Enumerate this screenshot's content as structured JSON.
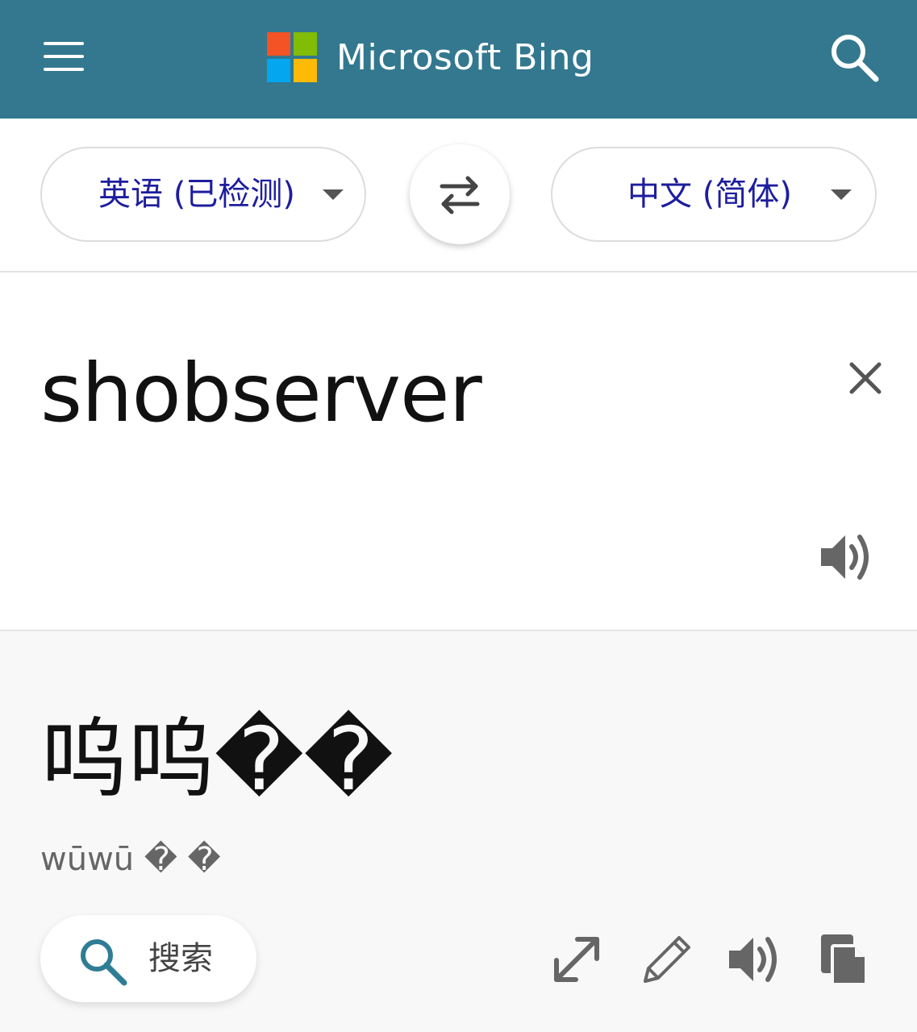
{
  "header": {
    "brand_name": "Microsoft Bing",
    "logo_colors": [
      "#f35325",
      "#81bc06",
      "#05a6f0",
      "#ffba08"
    ],
    "menu_icon": "hamburger-menu-icon",
    "search_icon": "search-icon",
    "background": "#33788f"
  },
  "languages": {
    "source_label": "英语 (已检测)",
    "target_label": "中文 (简体)",
    "swap_icon": "swap-arrows-icon",
    "label_color": "#1d1d9e"
  },
  "source": {
    "text": "shobserver",
    "clear_icon": "close-icon",
    "speak_icon": "speaker-icon"
  },
  "result": {
    "text": "呜呜��",
    "pinyin": "wūwū � �",
    "search_label": "搜索",
    "search_icon": "search-icon",
    "tools": [
      "expand-icon",
      "edit-pencil-icon",
      "speaker-icon",
      "copy-icon"
    ]
  }
}
